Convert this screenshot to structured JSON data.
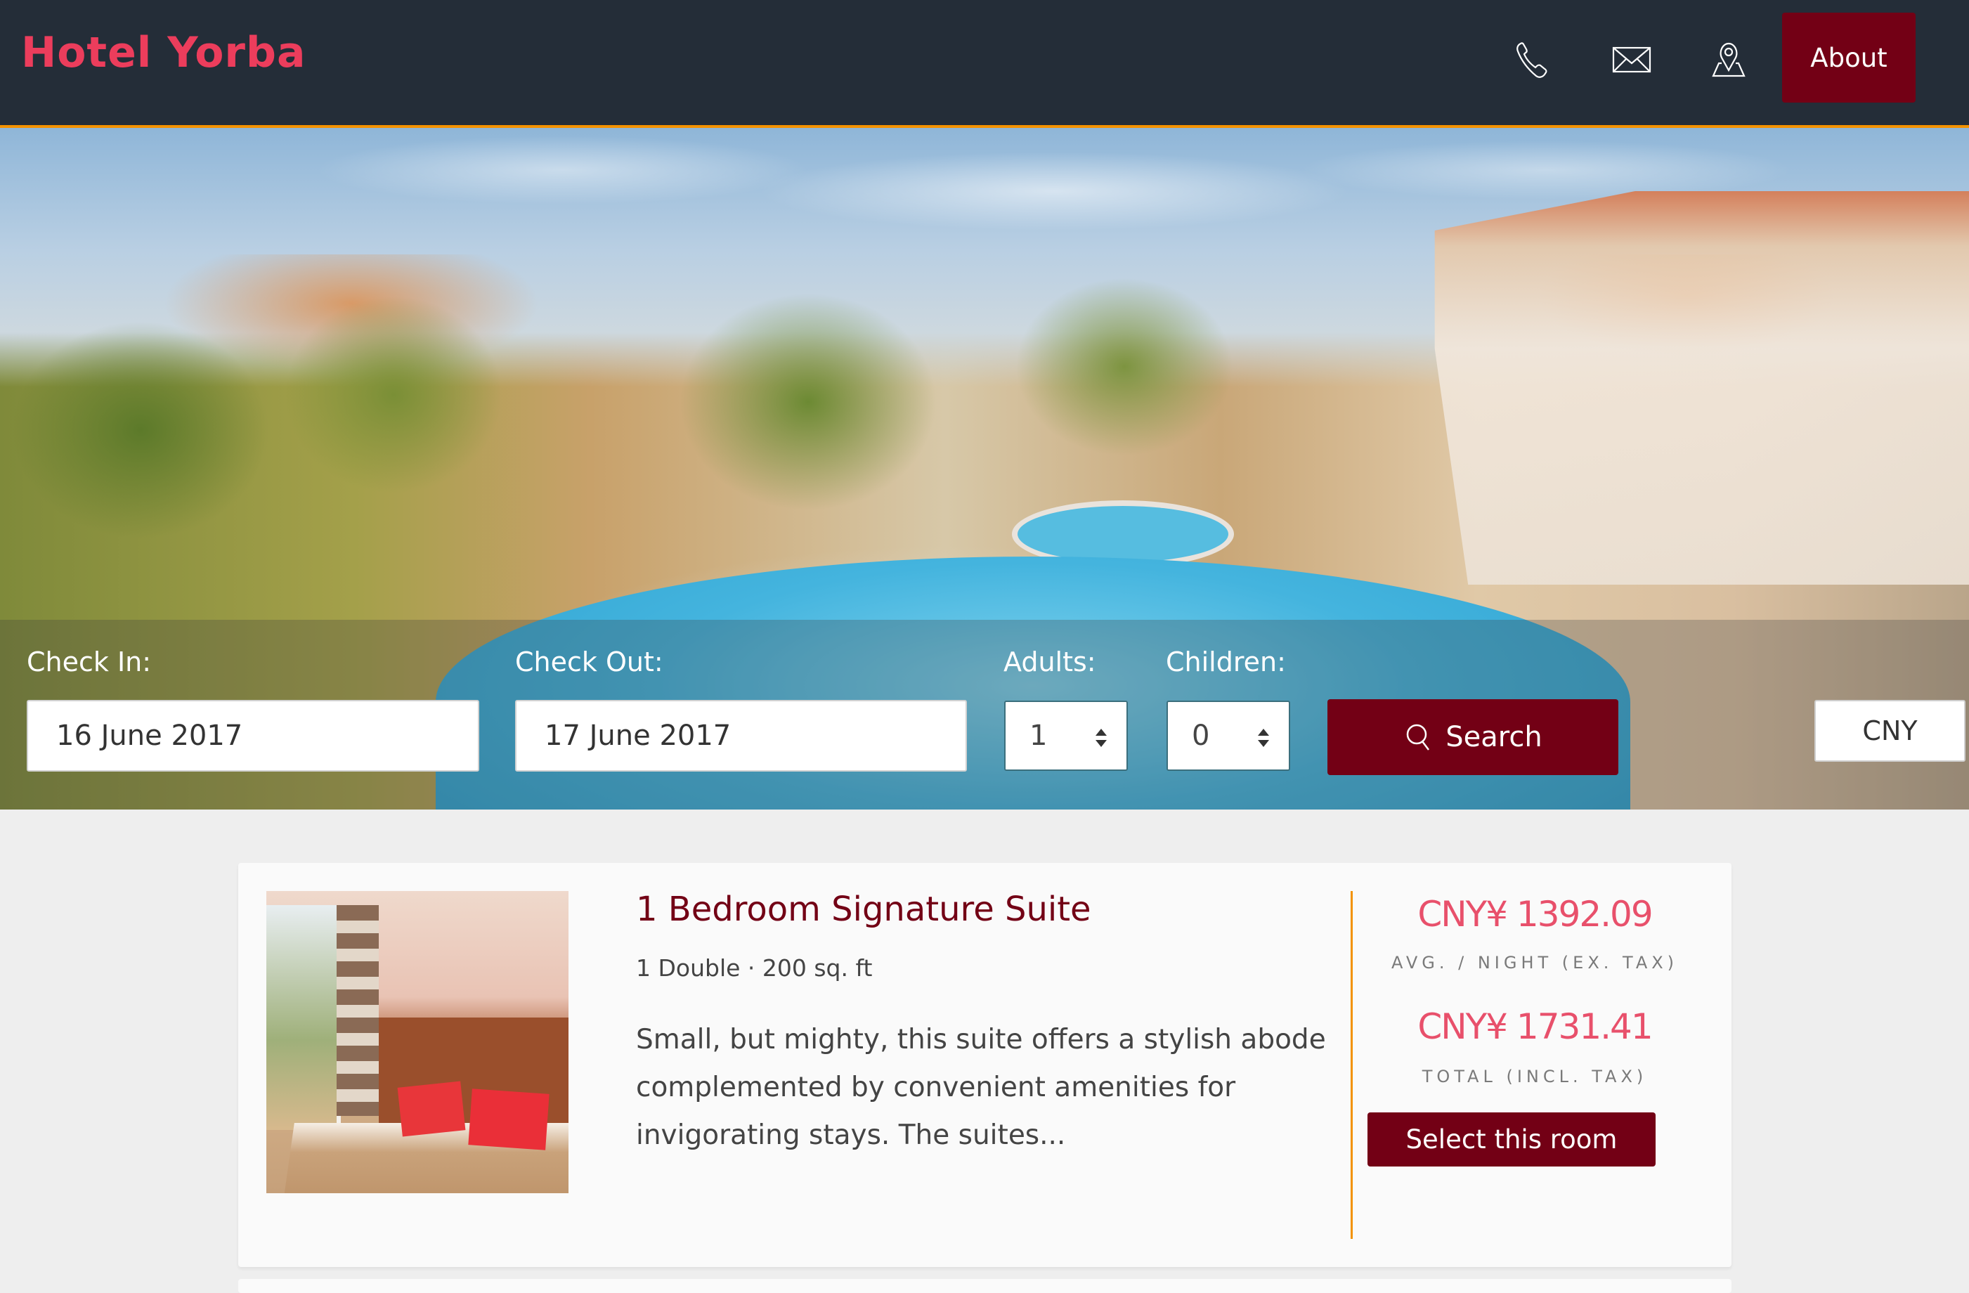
{
  "header": {
    "logo": "Hotel Yorba",
    "nav_icons": [
      {
        "name": "phone-icon"
      },
      {
        "name": "mail-icon"
      },
      {
        "name": "location-icon"
      }
    ],
    "about_label": "About",
    "colors": {
      "background": "#242d38",
      "accent_border": "#f39200",
      "logo": "#ec3d5c",
      "button": "#730015"
    }
  },
  "search": {
    "check_in": {
      "label": "Check In:",
      "value": "16 June 2017"
    },
    "check_out": {
      "label": "Check Out:",
      "value": "17 June 2017"
    },
    "adults": {
      "label": "Adults:",
      "value": "1"
    },
    "children": {
      "label": "Children:",
      "value": "0"
    },
    "search_label": "Search",
    "search_icon": "search-icon",
    "currency": "CNY"
  },
  "rooms": [
    {
      "title": "1 Bedroom Signature Suite",
      "subtitle": "1 Double · 200 sq. ft",
      "description": "Small, but mighty, this suite offers a stylish abode complemented by convenient amenities for invigorating stays. The suites...",
      "avg_price": "CNY¥ 1392.09",
      "avg_price_label": "AVG. / NIGHT (EX. TAX)",
      "total_price": "CNY¥ 1731.41",
      "total_price_label": "TOTAL (INCL. TAX)",
      "select_label": "Select this room"
    }
  ],
  "colors": {
    "brand": "#730015",
    "price": "#e8506b",
    "accent": "#f39200",
    "page_bg": "#eeeeee"
  }
}
